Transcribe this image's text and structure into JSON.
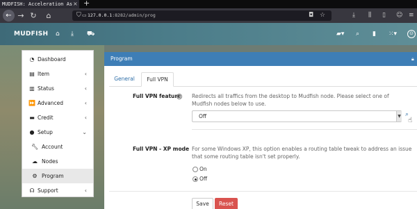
{
  "browser": {
    "tab_title": "MUDFISH: Acceleration As",
    "tab_close": "×",
    "new_tab": "+",
    "url_host": "127.0.0.1",
    "url_path": ":8282/admin/prog"
  },
  "header": {
    "brand": "MUDFISH"
  },
  "sidebar": {
    "items": [
      {
        "label": "Dashboard",
        "icon": "dashboard-icon",
        "chevron": ""
      },
      {
        "label": "Item",
        "icon": "item-icon",
        "chevron": "‹"
      },
      {
        "label": "Status",
        "icon": "status-icon",
        "chevron": "‹"
      },
      {
        "label": "Advanced",
        "icon": "advanced-icon",
        "chevron": "‹"
      },
      {
        "label": "Credit",
        "icon": "credit-icon",
        "chevron": "‹"
      },
      {
        "label": "Setup",
        "icon": "setup-icon",
        "chevron": "⌄"
      },
      {
        "label": "Account",
        "icon": "wrench-icon",
        "chevron": ""
      },
      {
        "label": "Nodes",
        "icon": "nodes-icon",
        "chevron": ""
      },
      {
        "label": "Program",
        "icon": "gear-icon",
        "chevron": ""
      },
      {
        "label": "Support",
        "icon": "headset-icon",
        "chevron": "‹"
      }
    ]
  },
  "panel": {
    "title": "Program",
    "tabs": [
      {
        "label": "General"
      },
      {
        "label": "Full VPN"
      }
    ],
    "fields": {
      "full_vpn_feature": {
        "label": "Full VPN feature",
        "description": "Redirects all traffics from the desktop to Mudfish node. Please select one of Mudfish nodes below to use.",
        "selected": "Off"
      },
      "xp_mode": {
        "label": "Full VPN - XP mode",
        "description": "For some Windows XP, this option enables a routing table tweak to address an issue that some routing table isn't set properly.",
        "options": [
          "On",
          "Off"
        ],
        "selected": "Off"
      }
    },
    "buttons": {
      "save": "Save",
      "reset": "Reset"
    }
  },
  "colors": {
    "accent": "#3e7eb6",
    "danger": "#d9534f"
  }
}
